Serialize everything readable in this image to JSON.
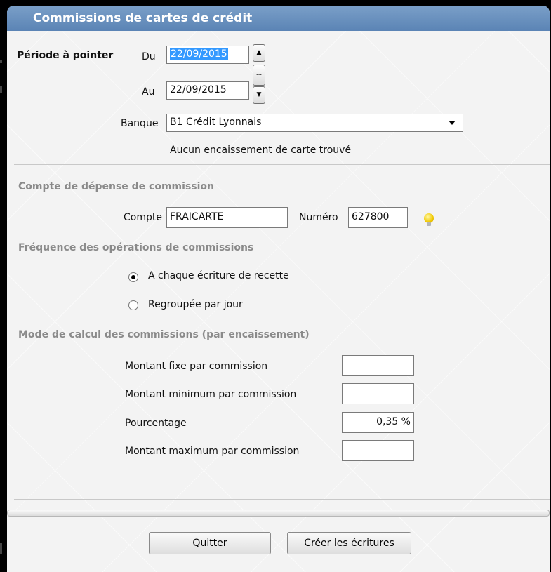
{
  "window": {
    "title": "Commissions de cartes de crédit"
  },
  "periode": {
    "label": "Période à pointer",
    "du_label": "Du",
    "du_value": "22/09/2015",
    "au_label": "Au",
    "au_value": "22/09/2015",
    "spin_more": "..."
  },
  "banque": {
    "label": "Banque",
    "value": "B1 Crédit Lyonnais",
    "status": "Aucun encaissement de carte trouvé"
  },
  "compte_section": {
    "title": "Compte de dépense de commission",
    "compte_label": "Compte",
    "compte_value": "FRAICARTE",
    "numero_label": "Numéro",
    "numero_value": "627800"
  },
  "frequence_section": {
    "title": "Fréquence des opérations de commissions",
    "options": [
      {
        "label": "A chaque écriture de recette",
        "selected": true
      },
      {
        "label": "Regroupée par jour",
        "selected": false
      }
    ]
  },
  "calcul_section": {
    "title": "Mode de calcul des commissions (par encaissement)",
    "fields": [
      {
        "label": "Montant fixe par commission",
        "value": ""
      },
      {
        "label": "Montant minimum par commission",
        "value": ""
      },
      {
        "label": "Pourcentage",
        "value": "0,35 %"
      },
      {
        "label": "Montant maximum par commission",
        "value": ""
      }
    ]
  },
  "buttons": {
    "quit": "Quitter",
    "create": "Créer les écritures"
  }
}
